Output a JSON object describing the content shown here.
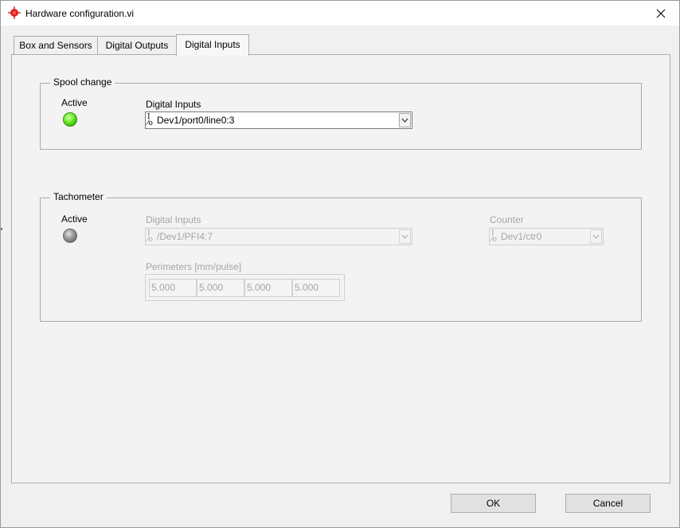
{
  "window": {
    "title": "Hardware configuration.vi"
  },
  "tabs": [
    {
      "label": "Box and Sensors"
    },
    {
      "label": "Digital Outputs"
    },
    {
      "label": "Digital Inputs",
      "active": true
    }
  ],
  "spool_change": {
    "title": "Spool change",
    "active_label": "Active",
    "active": true,
    "digital_inputs_label": "Digital Inputs",
    "digital_inputs_value": "Dev1/port0/line0:3"
  },
  "tachometer": {
    "title": "Tachometer",
    "active_label": "Active",
    "active": false,
    "digital_inputs_label": "Digital Inputs",
    "digital_inputs_value": "/Dev1/PFI4:7",
    "counter_label": "Counter",
    "counter_value": "Dev1/ctr0",
    "perimeters_label": "Perimeters [mm/pulse]",
    "perimeters": [
      "5.000",
      "5.000",
      "5.000",
      "5.000"
    ]
  },
  "buttons": {
    "ok": "OK",
    "cancel": "Cancel"
  },
  "colors": {
    "led_on": "#3cc20a",
    "led_off": "#808080",
    "app_icon": "#e02020"
  },
  "icons": {
    "app": "crosshair-target-icon",
    "close": "close-icon",
    "dropdown": "chevron-down-icon",
    "io": "io-name-icon"
  }
}
